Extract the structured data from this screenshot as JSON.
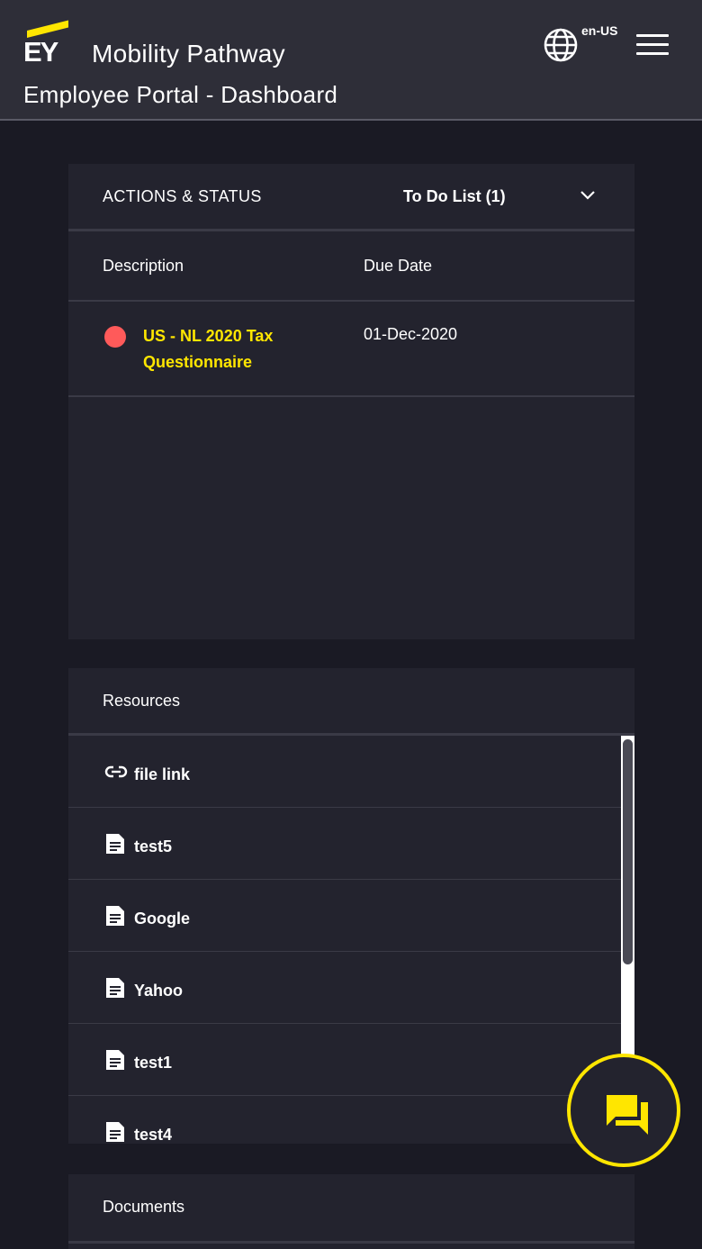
{
  "header": {
    "logo_text": "EY",
    "app_title": "Mobility Pathway",
    "page_title": "Employee Portal - Dashboard",
    "locale": "en-US",
    "icons": {
      "language": "globe-icon",
      "menu": "hamburger-menu-icon"
    }
  },
  "actions": {
    "title": "ACTIONS & STATUS",
    "filter_selected": "To Do List (1)",
    "columns": [
      "Description",
      "Due Date"
    ],
    "rows": [
      {
        "description": "US - NL 2020 Tax Questionnaire",
        "due_date": "01-Dec-2020",
        "status_color": "#ff5a5a"
      }
    ]
  },
  "resources": {
    "title": "Resources",
    "items": [
      {
        "label": "file link",
        "icon": "link-icon"
      },
      {
        "label": "test5",
        "icon": "document-icon"
      },
      {
        "label": "Google",
        "icon": "document-icon"
      },
      {
        "label": "Yahoo",
        "icon": "document-icon"
      },
      {
        "label": "test1",
        "icon": "document-icon"
      },
      {
        "label": "test4",
        "icon": "document-icon"
      }
    ]
  },
  "documents": {
    "title": "Documents"
  },
  "colors": {
    "accent": "#ffe600",
    "background": "#1a1a24",
    "panel": "#23232e",
    "header": "#2e2e38"
  }
}
